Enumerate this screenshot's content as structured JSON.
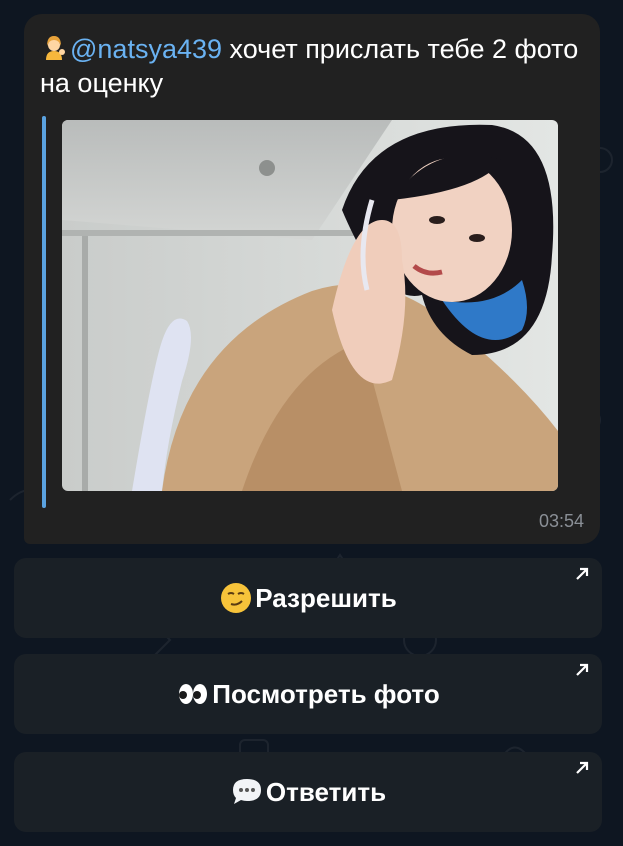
{
  "message": {
    "mention": "@natsya439",
    "text_after_mention": " хочет прислать тебе 2 фото на оценку",
    "time": "03:54",
    "person_emoji": "person-tipping-hand-icon"
  },
  "buttons": [
    {
      "label": "Разрешить",
      "emoji": "smirking-face-icon"
    },
    {
      "label": "Посмотреть фото",
      "emoji": "eyes-icon"
    },
    {
      "label": "Ответить",
      "emoji": "speech-balloon-icon"
    }
  ],
  "colors": {
    "background": "#0e1621",
    "bubble": "#212121",
    "mention": "#6ab2f2",
    "quote_bar": "#5aa2e0",
    "button_bg": "#1a2026"
  }
}
